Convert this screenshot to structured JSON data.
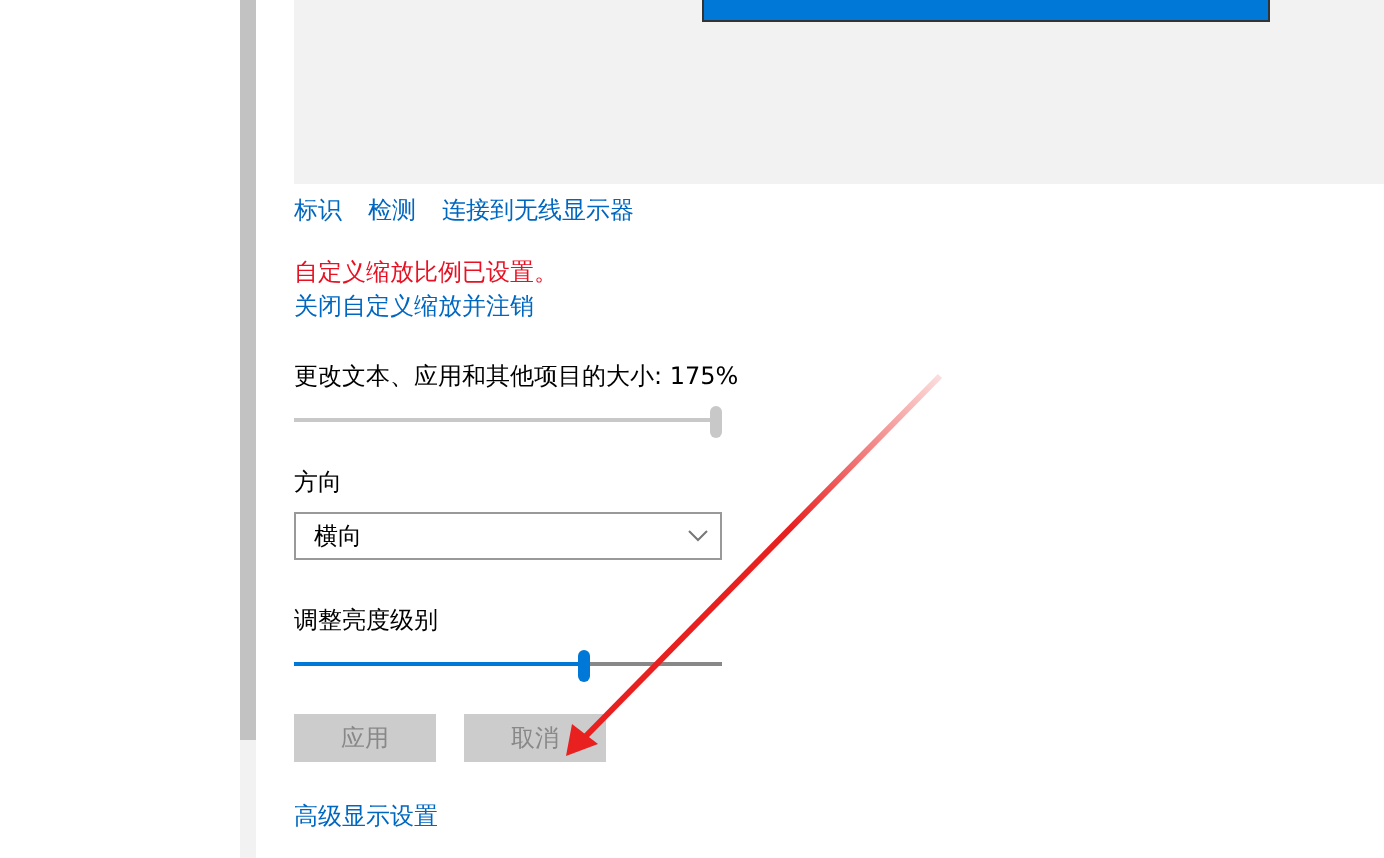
{
  "display_links": [
    {
      "label": "标识"
    },
    {
      "label": "检测"
    },
    {
      "label": "连接到无线显示器"
    }
  ],
  "scale_notice": {
    "message": "自定义缩放比例已设置。",
    "link": "关闭自定义缩放并注销"
  },
  "scale": {
    "label": "更改文本、应用和其他项目的大小: 175%",
    "level": 1.0
  },
  "orientation": {
    "label": "方向",
    "value": "横向"
  },
  "brightness": {
    "label": "调整亮度级别",
    "level": 0.69
  },
  "buttons": [
    {
      "label": "应用",
      "disabled": true
    },
    {
      "label": "取消",
      "disabled": true
    }
  ],
  "advanced_link": {
    "label": "高级显示设置"
  }
}
